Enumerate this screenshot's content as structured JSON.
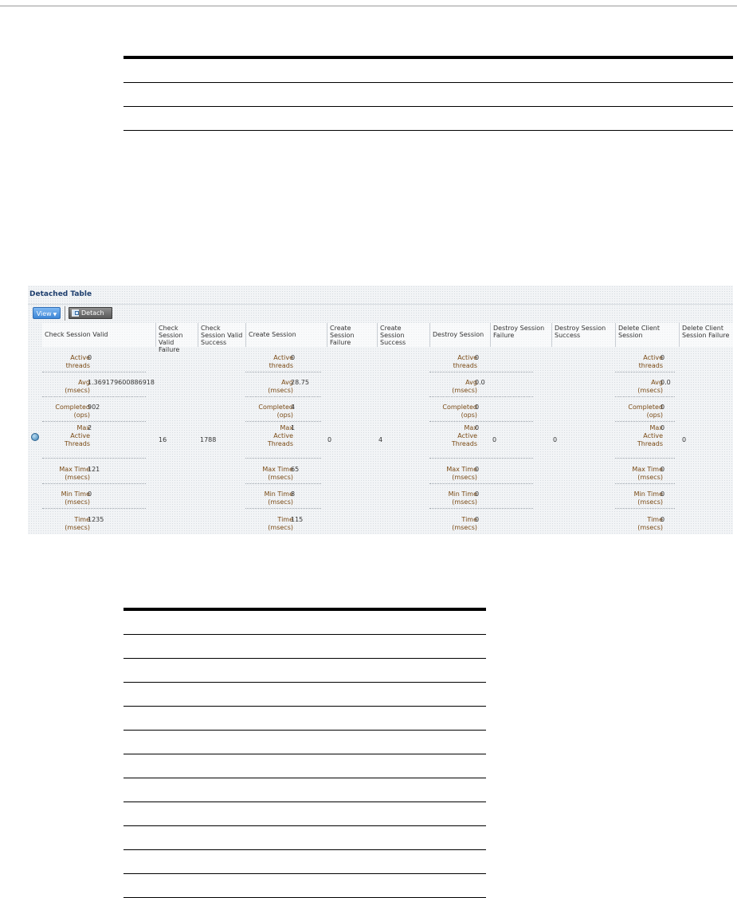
{
  "detached": {
    "title": "Detached Table",
    "view_label": "View",
    "detach_label": "Detach",
    "columns": [
      "Check Session Valid",
      "Check Session Valid Failure",
      "Check Session Valid Success",
      "Create Session",
      "Create Session Failure",
      "Create Session Success",
      "Destroy Session",
      "Destroy Session Failure",
      "Destroy Session Success",
      "Delete Client Session",
      "Delete Client Session Failure"
    ],
    "stat_labels": [
      {
        "line1": "Active",
        "line2": "threads"
      },
      {
        "line1": "Avg",
        "line2": "(msecs)"
      },
      {
        "line1": "Completed",
        "line2": "(ops)"
      },
      {
        "line1": "Max",
        "line2": "Active",
        "line3": "Threads"
      },
      {
        "line1": "Max Time",
        "line2": "(msecs)"
      },
      {
        "line1": "Min Time",
        "line2": "(msecs)"
      },
      {
        "line1": "Time",
        "line2": "(msecs)"
      }
    ],
    "groups": [
      {
        "values": [
          "0",
          "1.369179600886918",
          "902",
          "2",
          "121",
          "0",
          "1235"
        ]
      },
      {
        "values": [
          "0",
          "28.75",
          "4",
          "1",
          "65",
          "8",
          "115"
        ]
      },
      {
        "values": [
          "0",
          "0.0",
          "0",
          "0",
          "0",
          "0",
          "0"
        ]
      },
      {
        "values": [
          "0",
          "0.0",
          "0",
          "0",
          "0",
          "0",
          "0"
        ]
      }
    ],
    "plain_values": {
      "check_valid_failure": "16",
      "check_valid_success": "1788",
      "create_failure": "0",
      "create_success": "4",
      "destroy_failure": "0",
      "destroy_success": "0",
      "delete_client_failure": "0"
    }
  }
}
